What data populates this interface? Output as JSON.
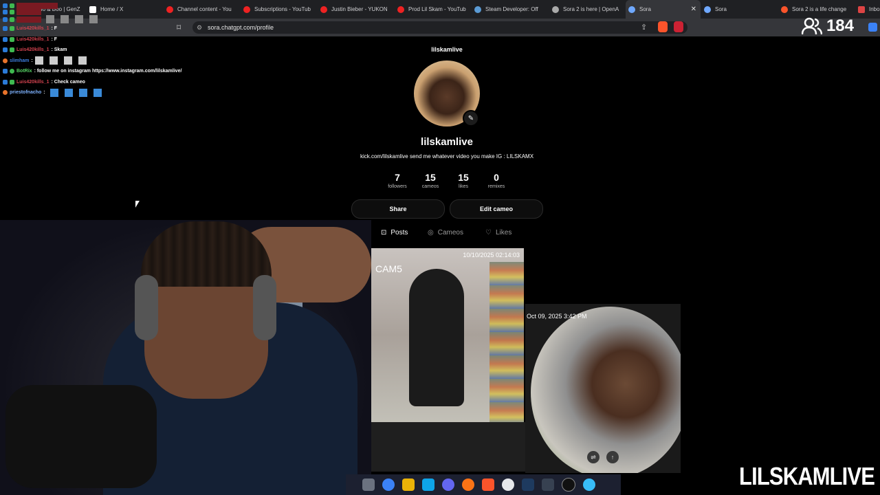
{
  "browser": {
    "tabs": [
      {
        "label": "Mano & Boo | GenZ",
        "active": false
      },
      {
        "label": "Home / X",
        "active": false
      },
      {
        "label": "Channel content - You",
        "active": false
      },
      {
        "label": "Subscriptions - YouTub",
        "active": false
      },
      {
        "label": "Justin Bieber - YUKON",
        "active": false
      },
      {
        "label": "Prod Lil Skam - YouTub",
        "active": false
      },
      {
        "label": "Steam Developer: Off",
        "active": false
      },
      {
        "label": "Sora 2 is here | OpenA",
        "active": false
      },
      {
        "label": "Sora",
        "active": true
      },
      {
        "label": "Sora",
        "active": false
      },
      {
        "label": "Sora 2 is a life change",
        "active": false
      },
      {
        "label": "Inbo",
        "active": false
      }
    ],
    "url": "sora.chatgpt.com/profile",
    "viewer_count": "184"
  },
  "chat": [
    {
      "user": "Luis420kills_1",
      "message": ": F",
      "user_color": "#d2424f"
    },
    {
      "user": "Luis420kills_1",
      "message": ": F",
      "user_color": "#d2424f"
    },
    {
      "user": "Luis420kills_1",
      "message": ": Skam",
      "user_color": "#d2424f"
    },
    {
      "user": "slimham",
      "message": ":",
      "user_color": "#3d7fe0"
    },
    {
      "user": "BotRix",
      "message": ": follow me on instagram https://www.instagram.com/lilskamlive/",
      "user_color": "#56d364"
    },
    {
      "user": "Luis420kills_1",
      "message": ": Check cameo",
      "user_color": "#d2424f"
    },
    {
      "user": "priestofnacho",
      "message": ":",
      "user_color": "#7fb3ff"
    }
  ],
  "profile": {
    "handle_header": "lilskamlive",
    "name": "lilskamlive",
    "bio": "kick.com/lilskamlive send me whatever video you make IG : LILSKAMX",
    "stats": [
      {
        "value": "7",
        "label": "followers"
      },
      {
        "value": "15",
        "label": "cameos"
      },
      {
        "value": "15",
        "label": "likes"
      },
      {
        "value": "0",
        "label": "remixes"
      }
    ],
    "share_label": "Share",
    "edit_label": "Edit cameo",
    "tabs": [
      {
        "label": "Posts",
        "active": true
      },
      {
        "label": "Cameos",
        "active": false
      },
      {
        "label": "Likes",
        "active": false
      }
    ],
    "posts": [
      {
        "overlay": "CAM5",
        "timestamp": "10/10/2025 02:14:03"
      },
      {
        "timestamp": "Oct 09, 2025 3:42 PM"
      }
    ]
  },
  "watermark": "LILSKAMLIVE",
  "colors": {
    "background": "#000000",
    "tab_bar": "#1f2023",
    "accent_brave": "#fb542b"
  }
}
